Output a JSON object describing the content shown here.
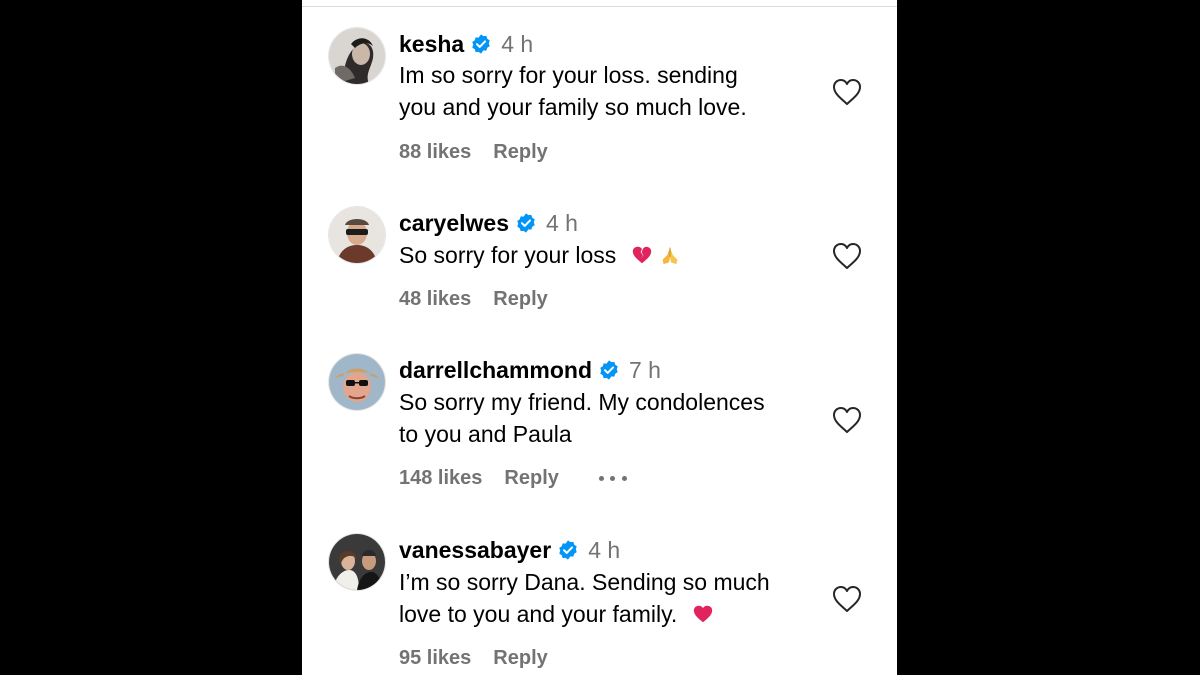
{
  "comments": [
    {
      "username": "kesha",
      "time": "4 h",
      "text_lines": [
        "Im so sorry for your loss. sending",
        "you and your family so much love."
      ],
      "likes": "88 likes",
      "reply": "Reply",
      "avatar": "avatar-kesha"
    },
    {
      "username": "caryelwes",
      "time": "4 h",
      "text": "So sorry for your loss",
      "emojis": [
        "broken-heart-emoji",
        "folded-hands-emoji"
      ],
      "likes": "48 likes",
      "reply": "Reply",
      "avatar": "avatar-caryelwes"
    },
    {
      "username": "darrellchammond",
      "time": "7 h",
      "text_lines": [
        "So sorry my friend. My condolences",
        "to you and Paula"
      ],
      "likes": "148 likes",
      "reply": "Reply",
      "more_icon": "more-options-icon",
      "avatar": "avatar-darrellchammond"
    },
    {
      "username": "vanessabayer",
      "time": "4 h",
      "text_lines": [
        "I’m so sorry Dana. Sending so much",
        "love to you and your family."
      ],
      "emojis": [
        "red-heart-emoji"
      ],
      "likes": "95 likes",
      "reply": "Reply",
      "avatar": "avatar-vanessabayer"
    }
  ],
  "colors": {
    "background": "#000000",
    "panel": "#ffffff",
    "text": "#000000",
    "secondary_text": "#737373",
    "verified_badge": "#0095f6"
  },
  "icons": {
    "verified": "verified-badge-icon",
    "like": "heart-outline-icon"
  }
}
